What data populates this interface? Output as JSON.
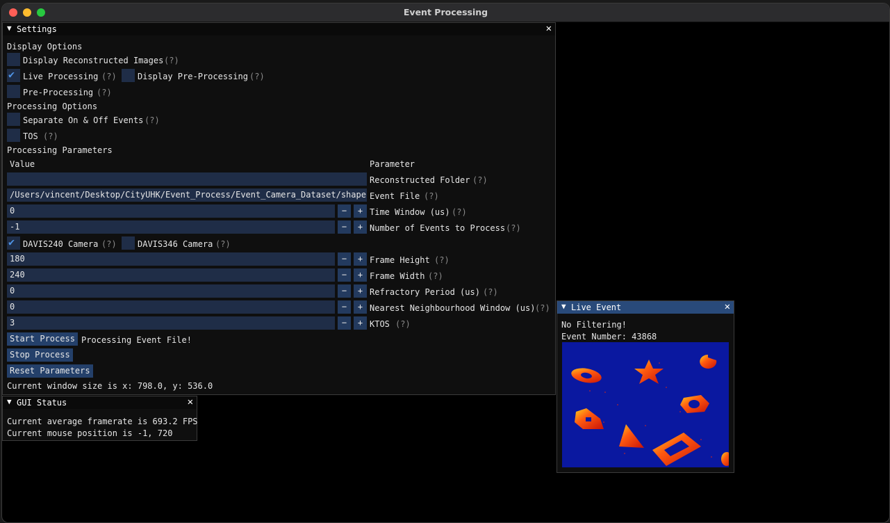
{
  "window": {
    "title": "Event Processing"
  },
  "settings": {
    "title": "Settings",
    "display_options_header": "Display Options",
    "display_reconstructed": {
      "label": "Display Reconstructed Images",
      "checked": false
    },
    "live_processing": {
      "label": "Live Processing",
      "checked": true
    },
    "display_pre_processing": {
      "label": "Display Pre-Processing",
      "checked": false
    },
    "pre_processing": {
      "label": "Pre-Processing",
      "checked": false
    },
    "processing_options_header": "Processing Options",
    "separate_on_off": {
      "label": "Separate On & Off Events",
      "checked": false
    },
    "tos": {
      "label": "TOS",
      "checked": false
    },
    "processing_parameters_header": "Processing Parameters",
    "col_value": "Value",
    "col_parameter": "Parameter",
    "help": "(?)",
    "minus": "−",
    "plus": "+",
    "params": {
      "reconstructed_folder": {
        "value": "",
        "label": "Reconstructed Folder"
      },
      "event_file": {
        "value": "/Users/vincent/Desktop/CityUHK/Event_Process/Event_Camera_Dataset/shapes_rotation/events.txt",
        "label": "Event File"
      },
      "time_window": {
        "value": "0",
        "label": "Time Window (us)"
      },
      "num_events": {
        "value": "-1",
        "label": "Number of Events to Process"
      },
      "davis240": {
        "label": "DAVIS240 Camera",
        "checked": true
      },
      "davis346": {
        "label": "DAVIS346 Camera",
        "checked": false
      },
      "frame_height": {
        "value": "180",
        "label": "Frame Height"
      },
      "frame_width": {
        "value": "240",
        "label": "Frame Width"
      },
      "refractory": {
        "value": "0",
        "label": "Refractory Period (us)"
      },
      "nn_window": {
        "value": "0",
        "label": "Nearest Neighbourhood Window (us)"
      },
      "ktos": {
        "value": "3",
        "label": "KTOS"
      }
    },
    "start_button": "Start Process",
    "status_text": "Processing Event File!",
    "stop_button": "Stop Process",
    "reset_button": "Reset Parameters",
    "window_size_text": "Current window size is x: 798.0, y: 536.0"
  },
  "gui_status": {
    "title": "GUI Status",
    "framerate_text": "Current average framerate is 693.2 FPS",
    "mouse_text": "Current mouse position is -1, 720"
  },
  "live_event": {
    "title": "Live Event",
    "filter_text": "No Filtering!",
    "event_number_text": "Event Number: 43868"
  },
  "colors": {
    "window_bg": "#0f0f0f",
    "frame_bg": "#1f2d47",
    "button": "#24406a",
    "title_active": "#294a7a",
    "check": "#4f94e6",
    "event_bg": "#0a18a0",
    "event_fg": "#e82a10"
  }
}
